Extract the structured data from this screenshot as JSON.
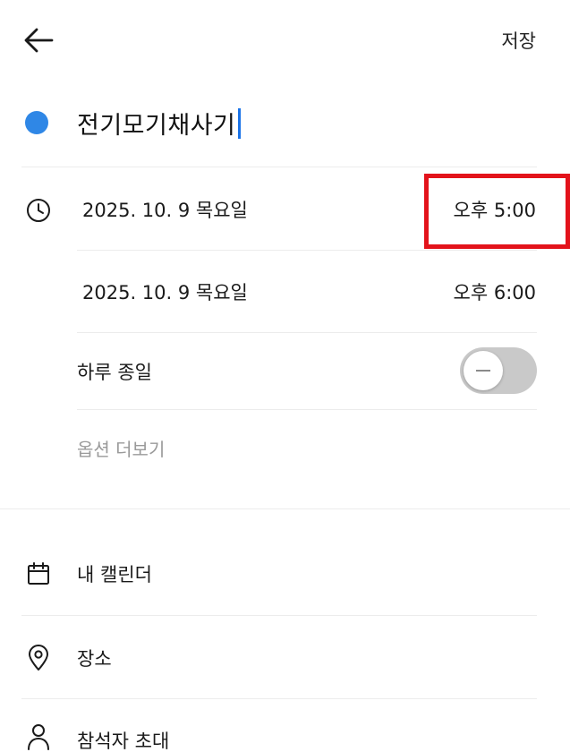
{
  "header": {
    "back_icon": "arrow-left-icon",
    "save_label": "저장"
  },
  "event": {
    "color": "#2f87e6",
    "title": "전기모기채사기"
  },
  "start": {
    "date": "2025. 10. 9 목요일",
    "time": "오후 5:00"
  },
  "end": {
    "date": "2025. 10. 9 목요일",
    "time": "오후 6:00"
  },
  "all_day": {
    "label": "하루 종일",
    "enabled": false
  },
  "more_options_label": "옵션 더보기",
  "details": {
    "calendar_label": "내 캘린더",
    "location_label": "장소",
    "attendees_label": "참석자 초대"
  },
  "highlight_color": "#e3131b"
}
